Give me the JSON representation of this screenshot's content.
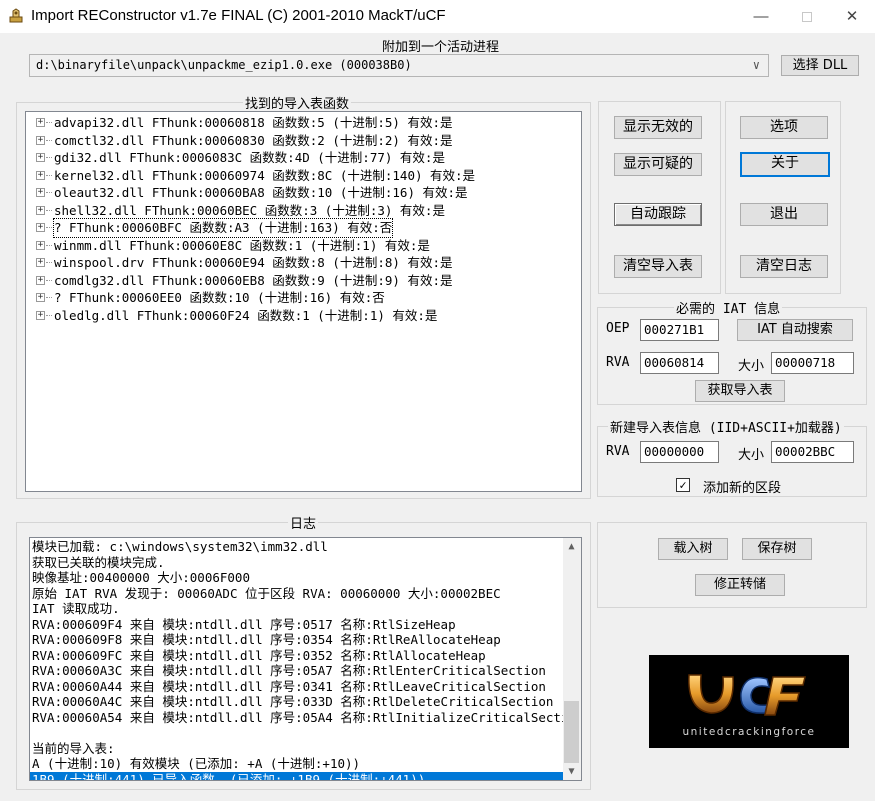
{
  "window": {
    "title": "Import REConstructor v1.7e FINAL (C) 2001-2010 MackT/uCF",
    "minimize_glyph": "—",
    "close_glyph": "✕"
  },
  "attach": {
    "group_label": "附加到一个活动进程",
    "process_value": "d:\\binaryfile\\unpack\\unpackme_ezip1.0.exe (000038B0)",
    "dropdown_glyph": "∨",
    "pick_dll_label": "选择 DLL"
  },
  "imports": {
    "group_label": "找到的导入表函数",
    "items": [
      {
        "label": "advapi32.dll FThunk:00060818 函数数:5 (十进制:5) 有效:是",
        "selected": false
      },
      {
        "label": "comctl32.dll FThunk:00060830 函数数:2 (十进制:2) 有效:是",
        "selected": false
      },
      {
        "label": "gdi32.dll FThunk:0006083C 函数数:4D (十进制:77) 有效:是",
        "selected": false
      },
      {
        "label": "kernel32.dll FThunk:00060974 函数数:8C (十进制:140) 有效:是",
        "selected": false
      },
      {
        "label": "oleaut32.dll FThunk:00060BA8 函数数:10 (十进制:16) 有效:是",
        "selected": false
      },
      {
        "label": "shell32.dll FThunk:00060BEC 函数数:3 (十进制:3) 有效:是",
        "selected": false
      },
      {
        "label": "? FThunk:00060BFC 函数数:A3 (十进制:163) 有效:否",
        "selected": true
      },
      {
        "label": "winmm.dll FThunk:00060E8C 函数数:1 (十进制:1) 有效:是",
        "selected": false
      },
      {
        "label": "winspool.drv FThunk:00060E94 函数数:8 (十进制:8) 有效:是",
        "selected": false
      },
      {
        "label": "comdlg32.dll FThunk:00060EB8 函数数:9 (十进制:9) 有效:是",
        "selected": false
      },
      {
        "label": "? FThunk:00060EE0 函数数:10 (十进制:16) 有效:否",
        "selected": false
      },
      {
        "label": "oledlg.dll FThunk:00060F24 函数数:1 (十进制:1) 有效:是",
        "selected": false
      }
    ],
    "expander_glyph": "+"
  },
  "buttons": {
    "show_invalid": "显示无效的",
    "show_suspect": "显示可疑的",
    "auto_trace": "自动跟踪",
    "clear_imports": "清空导入表",
    "options": "选项",
    "about": "关于",
    "exit": "退出",
    "clear_log": "清空日志"
  },
  "iat": {
    "group_label": "必需的 IAT 信息",
    "oep_label": "OEP",
    "oep_value": "000271B1",
    "autosearch_label": "IAT 自动搜索",
    "rva_label": "RVA",
    "rva_value": "00060814",
    "size_label": "大小",
    "size_value": "00000718",
    "get_imports_label": "获取导入表"
  },
  "new_import": {
    "group_label": "新建导入表信息 (IID+ASCII+加载器)",
    "rva_label": "RVA",
    "rva_value": "00000000",
    "size_label": "大小",
    "size_value": "00002BBC",
    "add_section_label": "添加新的区段",
    "add_section_checked": true,
    "check_glyph": "✓"
  },
  "log": {
    "group_label": "日志",
    "lines": [
      {
        "text": "模块已加载: c:\\windows\\system32\\imm32.dll",
        "selected": false
      },
      {
        "text": "获取已关联的模块完成.",
        "selected": false
      },
      {
        "text": "映像基址:00400000 大小:0006F000",
        "selected": false
      },
      {
        "text": "原始 IAT RVA 发现于: 00060ADC 位于区段 RVA: 00060000 大小:00002BEC",
        "selected": false
      },
      {
        "text": "IAT 读取成功.",
        "selected": false
      },
      {
        "text": "RVA:000609F4 来自 模块:ntdll.dll 序号:0517 名称:RtlSizeHeap",
        "selected": false
      },
      {
        "text": "RVA:000609F8 来自 模块:ntdll.dll 序号:0354 名称:RtlReAllocateHeap",
        "selected": false
      },
      {
        "text": "RVA:000609FC 来自 模块:ntdll.dll 序号:0352 名称:RtlAllocateHeap",
        "selected": false
      },
      {
        "text": "RVA:00060A3C 来自 模块:ntdll.dll 序号:05A7 名称:RtlEnterCriticalSection",
        "selected": false
      },
      {
        "text": "RVA:00060A44 来自 模块:ntdll.dll 序号:0341 名称:RtlLeaveCriticalSection",
        "selected": false
      },
      {
        "text": "RVA:00060A4C 来自 模块:ntdll.dll 序号:033D 名称:RtlDeleteCriticalSection",
        "selected": false
      },
      {
        "text": "RVA:00060A54 来自 模块:ntdll.dll 序号:05A4 名称:RtlInitializeCriticalSection",
        "selected": false
      },
      {
        "text": "",
        "selected": false
      },
      {
        "text": "当前的导入表:",
        "selected": false
      },
      {
        "text": "A (十进制:10) 有效模块 (已添加: +A (十进制:+10))",
        "selected": false
      },
      {
        "text": "1B9 (十进制:441) 已导入函数. (已添加: +1B9 (十进制:+441))",
        "selected": true
      }
    ],
    "scroll_up_glyph": "▲",
    "scroll_down_glyph": "▼",
    "scroll_position": 1.0
  },
  "tree_actions": {
    "load_tree": "载入树",
    "save_tree": "保存树",
    "fix_dump": "修正转储"
  },
  "logo": {
    "wordmark": "unitedcrackingforce",
    "monogram": "uCF"
  }
}
